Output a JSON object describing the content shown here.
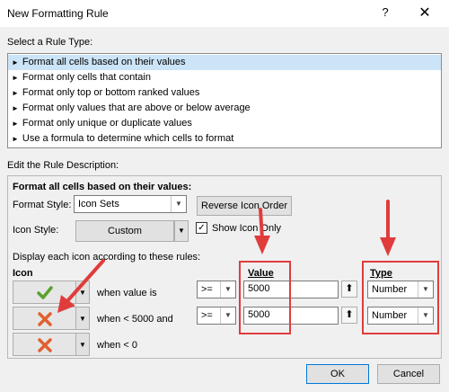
{
  "window": {
    "title": "New Formatting Rule",
    "help_label": "?",
    "close_label": "✕"
  },
  "rule_type": {
    "heading": "Select a Rule Type:",
    "items": [
      "Format all cells based on their values",
      "Format only cells that contain",
      "Format only top or bottom ranked values",
      "Format only values that are above or below average",
      "Format only unique or duplicate values",
      "Use a formula to determine which cells to format"
    ],
    "selected_index": 0
  },
  "description": {
    "heading": "Edit the Rule Description:",
    "subheading": "Format all cells based on their values:",
    "format_style_label": "Format Style:",
    "format_style_value": "Icon Sets",
    "reverse_button": "Reverse Icon Order",
    "icon_style_label": "Icon Style:",
    "icon_style_value": "Custom",
    "show_icon_only_label": "Show Icon Only",
    "show_icon_only_checked": true,
    "display_instruction": "Display each icon according to these rules:",
    "col_icon": "Icon",
    "col_value": "Value",
    "col_type": "Type",
    "rules": [
      {
        "icon": "check-mark-icon",
        "condition": "when value is",
        "operator": ">=",
        "value": "5000",
        "type": "Number"
      },
      {
        "icon": "x-mark-icon",
        "condition": "when < 5000 and",
        "operator": ">=",
        "value": "5000",
        "type": "Number"
      },
      {
        "icon": "x-mark-icon",
        "condition": "when < 0"
      }
    ]
  },
  "footer": {
    "ok": "OK",
    "cancel": "Cancel"
  },
  "colors": {
    "accent_red": "#e03c3c",
    "check_green": "#5aa02c",
    "x_red": "#e06030",
    "selection": "#cce4f7"
  }
}
